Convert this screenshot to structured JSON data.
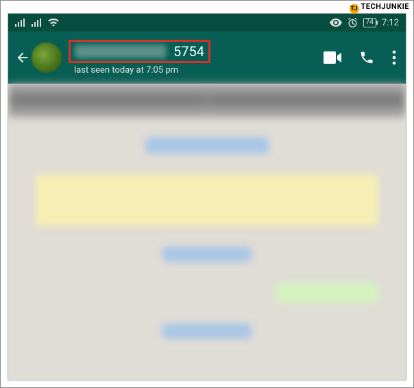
{
  "watermark": {
    "badge": "TJ",
    "text": "TECHJUNKIE"
  },
  "statusbar": {
    "battery_pct": "74",
    "time": "7:12"
  },
  "header": {
    "contact_number_visible": "5754",
    "last_seen": "last seen today at 7:05 pm"
  }
}
